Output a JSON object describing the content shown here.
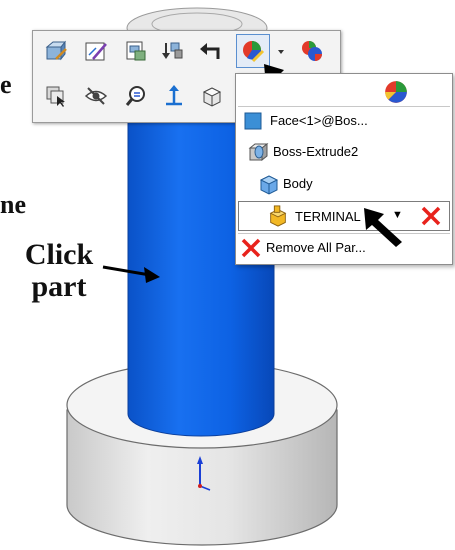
{
  "left_text": {
    "fragment_1": "e",
    "fragment_2": "ne"
  },
  "annotation": {
    "line1": "Click",
    "line2": "part"
  },
  "toolbar": {
    "row1": [
      "edit-part-icon",
      "edit-sketch-icon",
      "edit-feature-icon",
      "rebuild-icon",
      "back-arrow-icon",
      "appearance-icon",
      "dropdown-arrow-icon",
      "appearance-alt-icon"
    ],
    "row2": [
      "select-other-icon",
      "hide-icon",
      "zoom-to-selection-icon",
      "normal-to-icon",
      "view-orientation-icon"
    ]
  },
  "menu": {
    "items": [
      {
        "label": "Face<1>@Bos...",
        "icon": "face-icon"
      },
      {
        "label": "Boss-Extrude2",
        "icon": "feature-icon"
      },
      {
        "label": "Body",
        "icon": "body-icon"
      },
      {
        "label": "TERMINAL",
        "icon": "part-icon",
        "caret": "▼"
      },
      {
        "label": "Remove All Par...",
        "icon": "remove-x-icon"
      }
    ]
  },
  "colors": {
    "cylinder_blue": "#0a5fe0",
    "menu_face_blue": "#3b8fd6",
    "remove_red": "#e8221c",
    "part_yellow": "#f2b824",
    "arrow_black": "#000000"
  }
}
